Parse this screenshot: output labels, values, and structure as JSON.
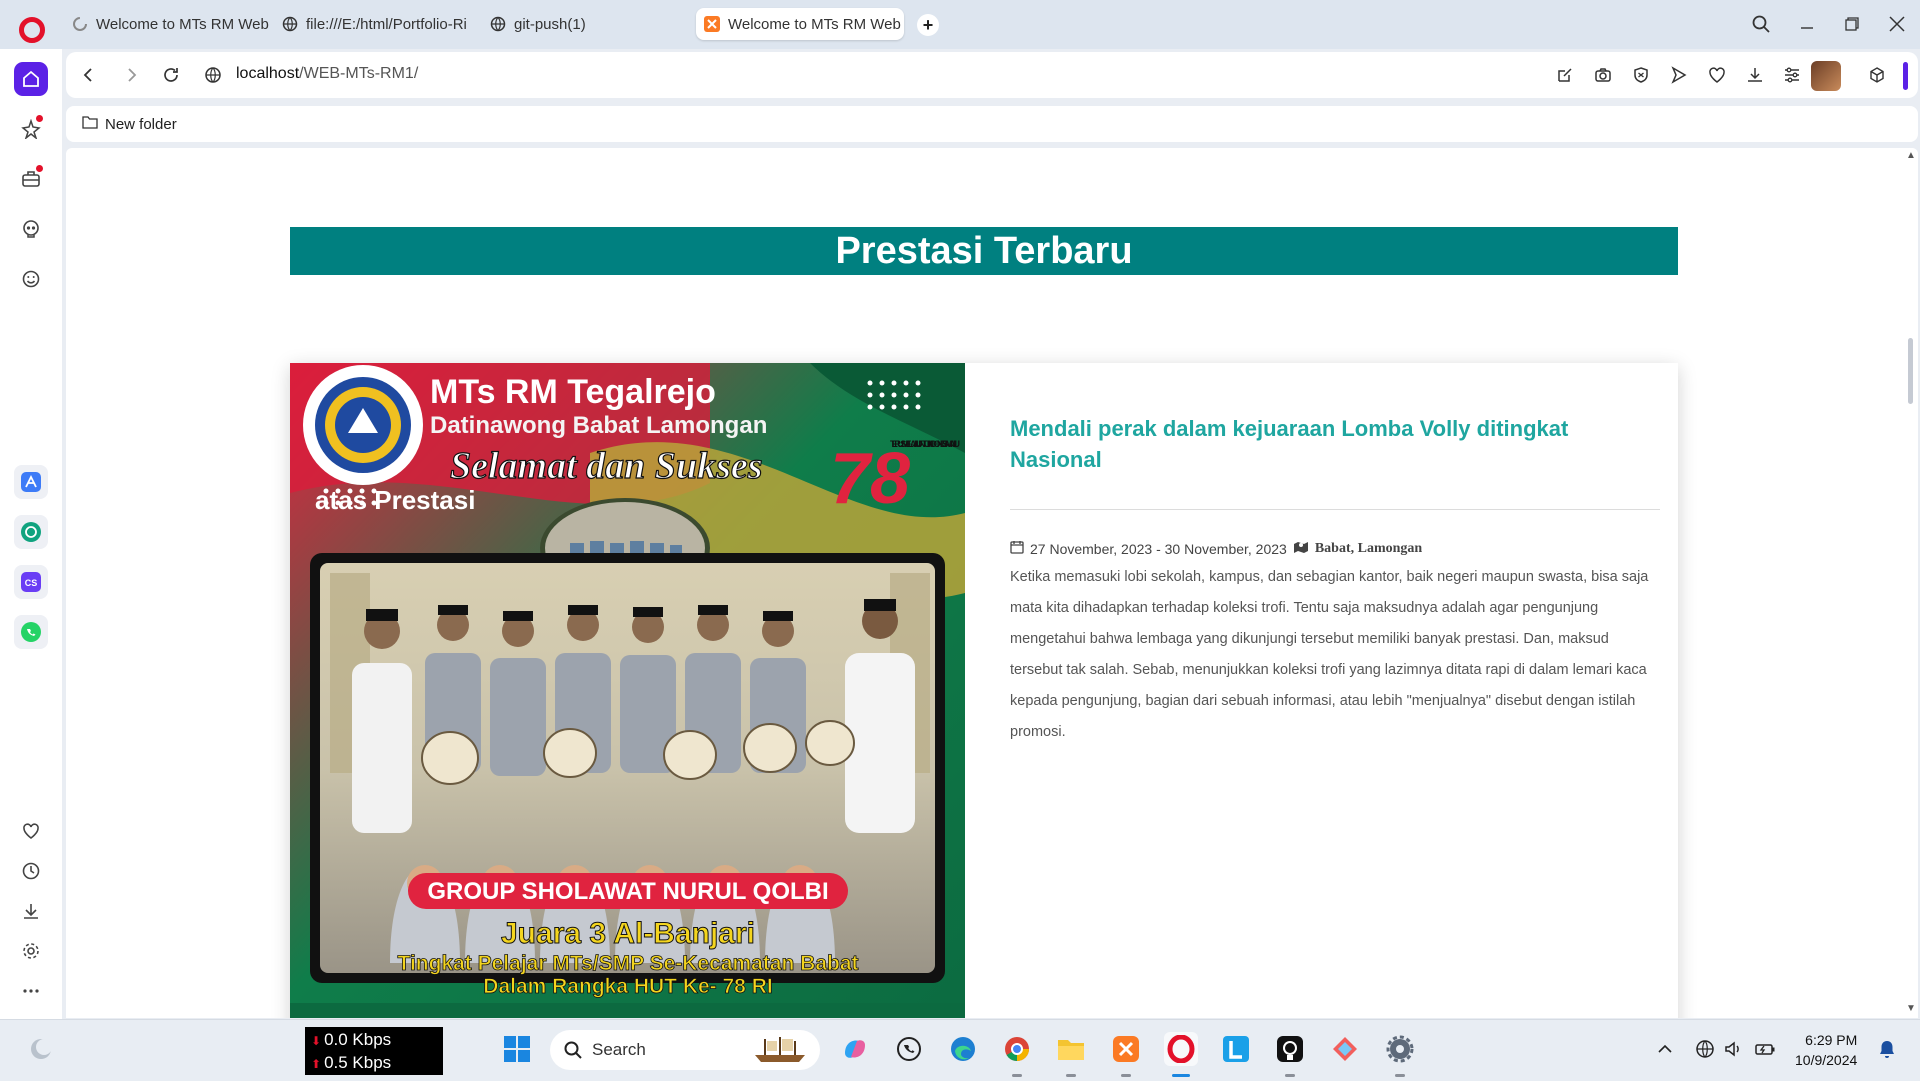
{
  "browser": {
    "tabs": [
      {
        "label": "Welcome to MTs RM Web"
      },
      {
        "label": "file:///E:/html/Portfolio-Ri"
      },
      {
        "label": "git-push(1)"
      },
      {
        "label": "Welcome to MTs RM Web"
      }
    ],
    "url_host": "localhost",
    "url_path": "/WEB-MTs-RM1/",
    "bookmark": "New folder"
  },
  "page": {
    "section_title": "Prestasi Terbaru",
    "achievement": {
      "title": "Mendali perak dalam kejuaraan Lomba Volly ditingkat Nasional",
      "date": "27 November, 2023 - 30 November, 2023",
      "location": "Babat, Lamongan",
      "description": "Ketika memasuki lobi sekolah, kampus, dan sebagian kantor, baik negeri maupun swasta, bisa saja mata kita dihadapkan terhadap koleksi trofi. Tentu saja maksudnya adalah agar pengunjung mengetahui bahwa lembaga yang dikunjungi tersebut memiliki banyak prestasi. Dan, maksud tersebut tak salah. Sebab, menunjukkan koleksi trofi yang lazimnya ditata rapi di dalam lemari kaca kepada pengunjung, bagian dari sebuah informasi, atau lebih \"menjualnya\" disebut dengan istilah promosi."
    },
    "poster": {
      "school": "MTs RM Tegalrejo",
      "region": "Datinawong Babat Lamongan",
      "greeting": "Selamat dan Sukses",
      "subtitle": "atas Prestasi",
      "slogan": "TERUS MELAJU UNTUK INDONESIA MAJU",
      "anniversary": "78",
      "group": "GROUP SHOLAWAT NURUL QOLBI",
      "rank": "Juara 3 Al-Banjari",
      "level": "Tingkat Pelajar MTs/SMP Se-Kecamatan Babat",
      "occasion": "Dalam Rangka HUT Ke- 78 RI"
    }
  },
  "taskbar": {
    "net_down": "0.0 Kbps",
    "net_up": "0.5 Kbps",
    "search_placeholder": "Search",
    "time": "6:29 PM",
    "date": "10/9/2024"
  },
  "colors": {
    "accent_teal": "#008080",
    "title_teal": "#1fa6a0",
    "opera_red": "#e3112a",
    "sidebar_purple": "#5b21e6"
  }
}
